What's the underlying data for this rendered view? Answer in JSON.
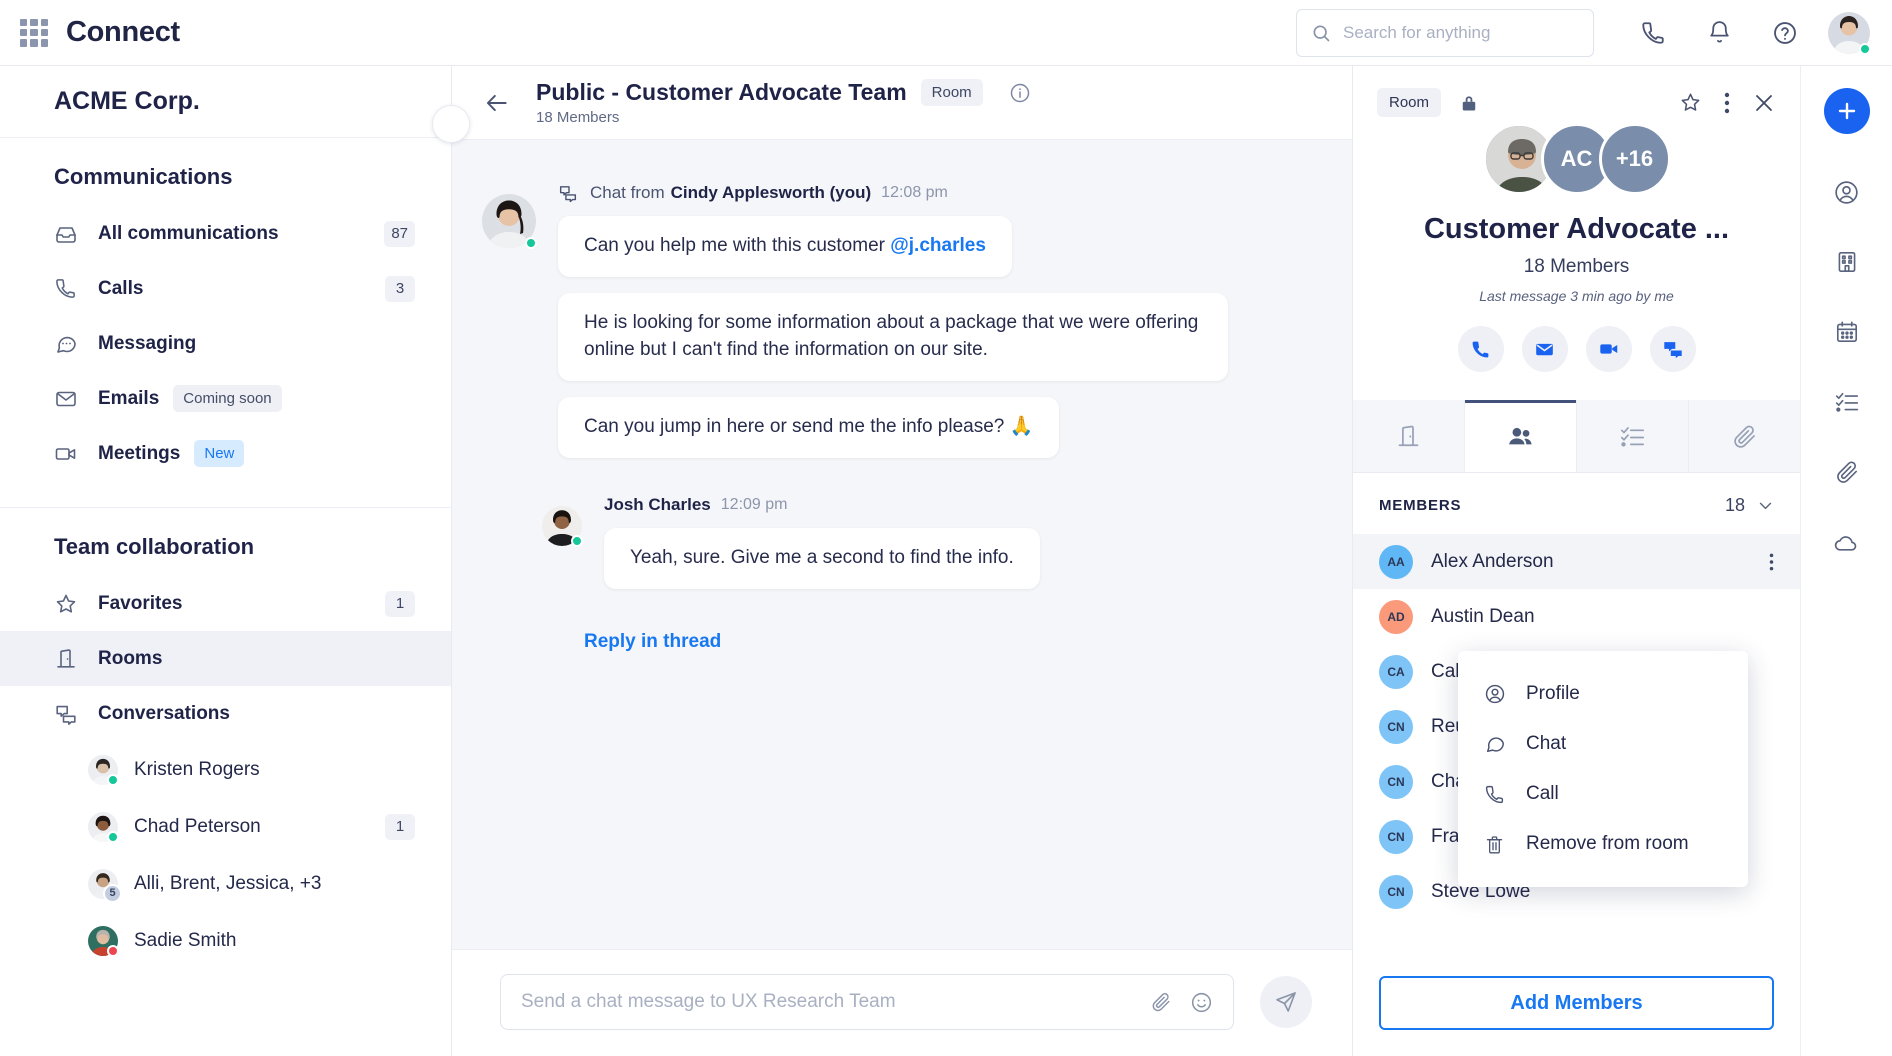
{
  "topbar": {
    "brand": "Connect",
    "grid_icon": "app-grid-icon",
    "search": {
      "placeholder": "Search for anything",
      "icon": "search-icon"
    },
    "icons": [
      {
        "name": "phone-icon"
      },
      {
        "name": "bell-icon"
      },
      {
        "name": "help-icon"
      }
    ],
    "avatar": {
      "name": "user-avatar",
      "status": "green"
    }
  },
  "sidebar": {
    "org_name": "ACME Corp.",
    "collapse_icon": "chevron-left-icon",
    "sections": [
      {
        "title": "Communications",
        "items": [
          {
            "label": "All communications",
            "icon": "inbox-icon",
            "badge": "87",
            "pill": null,
            "active": false
          },
          {
            "label": "Calls",
            "icon": "phone-icon",
            "badge": "3",
            "pill": null,
            "active": false
          },
          {
            "label": "Messaging",
            "icon": "chat-bubble-icon",
            "badge": null,
            "pill": null,
            "active": false
          },
          {
            "label": "Emails",
            "icon": "envelope-icon",
            "badge": null,
            "pill": {
              "text": "Coming soon",
              "style": "soon"
            },
            "active": false
          },
          {
            "label": "Meetings",
            "icon": "video-icon",
            "badge": null,
            "pill": {
              "text": "New",
              "style": "new"
            },
            "active": false
          }
        ]
      },
      {
        "title": "Team collaboration",
        "items": [
          {
            "label": "Favorites",
            "icon": "star-icon",
            "badge": "1",
            "pill": null,
            "active": false
          },
          {
            "label": "Rooms",
            "icon": "door-icon",
            "badge": null,
            "pill": null,
            "active": true
          },
          {
            "label": "Conversations",
            "icon": "conversations-icon",
            "badge": null,
            "pill": null,
            "active": false
          }
        ]
      }
    ],
    "conversations": [
      {
        "name": "Kristen Rogers",
        "status": "green",
        "badge": null,
        "count": null,
        "skin": "#d9c0a8",
        "hair": "#2a2424"
      },
      {
        "name": "Chad Peterson",
        "status": "green",
        "badge": "1",
        "count": null,
        "skin": "#8d5c3c",
        "hair": "#1d1512"
      },
      {
        "name": "Alli, Brent, Jessica, +3",
        "status": null,
        "badge": null,
        "count": "5",
        "skin": "#c9a183",
        "hair": "#33281f"
      },
      {
        "name": "Sadie Smith",
        "status": "red",
        "badge": null,
        "count": null,
        "skin": "#e0bda0",
        "hair": "#b9b3ad"
      }
    ]
  },
  "chat": {
    "back_icon": "arrow-left-icon",
    "title": "Public - Customer Advocate Team",
    "tag": "Room",
    "subtitle": "18 Members",
    "info_icon": "info-icon",
    "groups": [
      {
        "lead": "Chat from",
        "author": "Cindy Applesworth (you)",
        "time": "12:08 pm",
        "has_chat_icon": true,
        "avatar_size": "lg",
        "status": "green",
        "skin": "#e6c3a5",
        "hair": "#1c1614",
        "messages": [
          {
            "text": "Can you help me with this customer ",
            "mention": "@j.charles",
            "after": ""
          },
          {
            "text": "He is looking for some information about a package that we were offering online but I can't find the information on our site.",
            "mention": null,
            "after": ""
          },
          {
            "text": "Can you jump in here or send me the info please? 🙏",
            "mention": null,
            "after": ""
          }
        ]
      },
      {
        "lead": "",
        "author": "Josh Charles",
        "time": "12:09 pm",
        "has_chat_icon": false,
        "avatar_size": "sm",
        "status": "green",
        "skin": "#8f6243",
        "hair": "#191310",
        "messages": [
          {
            "text": "Yeah, sure. Give me a second to find the info.",
            "mention": null,
            "after": ""
          }
        ]
      }
    ],
    "reply_in_thread": "Reply in thread",
    "composer": {
      "placeholder": "Send a chat message to UX Research Team",
      "attach_icon": "paperclip-icon",
      "emoji_icon": "emoji-icon",
      "send_icon": "send-icon"
    }
  },
  "right_panel": {
    "tag": "Room",
    "lock_icon": "lock-icon",
    "top_icons": [
      {
        "name": "star-icon"
      },
      {
        "name": "kebab-menu-icon"
      },
      {
        "name": "close-icon"
      }
    ],
    "avatar_stack": [
      {
        "type": "photo",
        "label": "",
        "skin": "#d8b294",
        "hair": "#6d6a66"
      },
      {
        "type": "initials",
        "label": "AC"
      },
      {
        "type": "initials",
        "label": "+16"
      }
    ],
    "title": "Customer Advocate ...",
    "members_line": "18 Members",
    "last_message": "Last message 3 min ago by me",
    "actions": [
      {
        "name": "call-action-icon"
      },
      {
        "name": "email-action-icon"
      },
      {
        "name": "video-action-icon"
      },
      {
        "name": "chat-action-icon"
      }
    ],
    "tabs": [
      {
        "name": "tab-room",
        "icon": "door-icon",
        "active": false
      },
      {
        "name": "tab-members",
        "icon": "people-icon",
        "active": true
      },
      {
        "name": "tab-tasks",
        "icon": "checklist-icon",
        "active": false
      },
      {
        "name": "tab-files",
        "icon": "paperclip-icon",
        "active": false
      }
    ],
    "members_header": {
      "label": "MEMBERS",
      "count": "18",
      "chevron": "chevron-down-icon"
    },
    "members": [
      {
        "initials": "AA",
        "name": "Alex Anderson",
        "color": "#5fb8f5",
        "selected": true
      },
      {
        "initials": "AD",
        "name": "Austin Dean",
        "color": "#fb9a7a",
        "selected": false
      },
      {
        "initials": "CA",
        "name": "Callie Ander",
        "color": "#7ec4f7",
        "selected": false
      },
      {
        "initials": "CN",
        "name": "Reuben Nash",
        "color": "#7ec4f7",
        "selected": false
      },
      {
        "initials": "CN",
        "name": "Chad Nelson",
        "color": "#7ec4f7",
        "selected": false
      },
      {
        "initials": "CN",
        "name": "Frank Meza",
        "color": "#7ec4f7",
        "selected": false
      },
      {
        "initials": "CN",
        "name": "Steve Lowe",
        "color": "#7ec4f7",
        "selected": false
      }
    ],
    "add_members_button": "Add Members",
    "context_menu": [
      {
        "label": "Profile",
        "icon": "profile-icon"
      },
      {
        "label": "Chat",
        "icon": "chat-bubble-icon"
      },
      {
        "label": "Call",
        "icon": "phone-icon"
      },
      {
        "label": "Remove from room",
        "icon": "trash-icon"
      }
    ]
  },
  "rail": {
    "plus_icon": "plus-icon",
    "items": [
      {
        "name": "contacts-icon"
      },
      {
        "name": "company-icon"
      },
      {
        "name": "calendar-icon"
      },
      {
        "name": "checklist-icon"
      },
      {
        "name": "paperclip-icon"
      },
      {
        "name": "cloud-icon"
      }
    ]
  },
  "colors": {
    "accent": "#1878f2",
    "rail_plus": "#1a63f0",
    "text": "#1f2347",
    "muted": "#8c95ab",
    "online": "#16c79a",
    "busy": "#f0454f"
  }
}
